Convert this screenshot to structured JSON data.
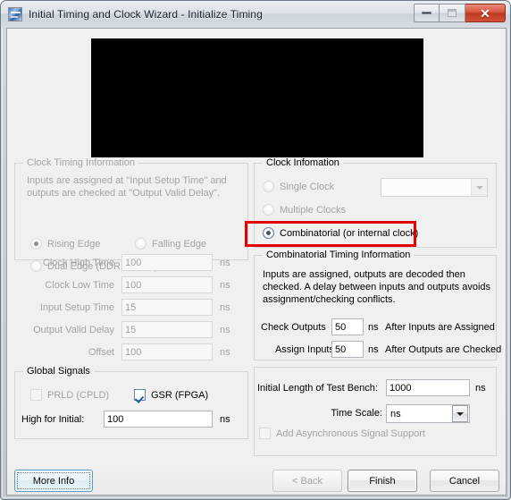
{
  "window": {
    "title": "Initial Timing and Clock Wizard - Initialize Timing",
    "app_icon": "app-waveform-icon",
    "buttons": {
      "minimize": "minimize-icon",
      "maximize": "maximize-icon",
      "close": "✕"
    }
  },
  "preview": {
    "name": "waveform-preview-canvas",
    "background_color": "#000000"
  },
  "clock_timing_information": {
    "title": "Clock Timing Information",
    "description": "Inputs are assigned at \"Input Setup Time\" and outputs are checked at \"Output Valid Delay\".",
    "description_line1": "Inputs are assigned at \"Input Setup Time\" and",
    "description_line2": "outputs are checked at \"Output Valid Delay\".",
    "edge_options": [
      {
        "label": "Rising Edge",
        "selected": true,
        "enabled": false
      },
      {
        "label": "Falling Edge",
        "selected": false,
        "enabled": false
      },
      {
        "label": "Dual Edge (DDR or DET)",
        "selected": false,
        "enabled": false
      }
    ],
    "fields": [
      {
        "label": "Clock High Time",
        "value": "100",
        "unit": "ns",
        "enabled": false
      },
      {
        "label": "Clock Low Time",
        "value": "100",
        "unit": "ns",
        "enabled": false
      },
      {
        "label": "Input Setup Time",
        "value": "15",
        "unit": "ns",
        "enabled": false
      },
      {
        "label": "Output Valid Delay",
        "value": "15",
        "unit": "ns",
        "enabled": false
      },
      {
        "label": "Offset",
        "value": "100",
        "unit": "ns",
        "enabled": false
      }
    ]
  },
  "global_signals": {
    "title": "Global Signals",
    "prld": {
      "label": "PRLD (CPLD)",
      "checked": false,
      "enabled": false
    },
    "gsr": {
      "label": "GSR (FPGA)",
      "checked": true,
      "enabled": true
    },
    "high_for_initial": {
      "label": "High for Initial:",
      "value": "100",
      "unit": "ns"
    }
  },
  "clock_information": {
    "title": "Clock Infomation",
    "options": [
      {
        "label": "Single Clock",
        "selected": false,
        "enabled": false
      },
      {
        "label": "Multiple Clocks",
        "selected": false,
        "enabled": false
      },
      {
        "label": "Combinatorial (or internal clock)",
        "selected": true,
        "enabled": true
      }
    ],
    "clock_select": {
      "value": "",
      "enabled": false
    },
    "highlight_color": "#e50000"
  },
  "combinatorial_timing_information": {
    "title": "Combinatorial Timing Information",
    "description_line1": "Inputs are assigned, outputs are decoded then",
    "description_line2": "checked.  A delay between inputs and outputs avoids",
    "description_line3": "assignment/checking conflicts.",
    "check_outputs": {
      "label": "Check Outputs",
      "value": "50",
      "unit": "ns",
      "suffix": "After Inputs are Assigned"
    },
    "assign_inputs": {
      "label": "Assign Inputs",
      "value": "50",
      "unit": "ns",
      "suffix": "After Outputs are Checked"
    }
  },
  "test_bench": {
    "initial_length": {
      "label": "Initial Length of Test Bench:",
      "value": "1000",
      "unit": "ns"
    },
    "time_scale": {
      "label": "Time Scale:",
      "value": "ns",
      "enabled": true
    },
    "async_support": {
      "label": "Add Asynchronous Signal Support",
      "checked": false,
      "enabled": false
    }
  },
  "footer": {
    "more_info": {
      "label": "More Info",
      "enabled": true,
      "focused": true
    },
    "back": {
      "label": "< Back",
      "enabled": false
    },
    "finish": {
      "label": "Finish",
      "enabled": true,
      "default": true
    },
    "cancel": {
      "label": "Cancel",
      "enabled": true
    }
  }
}
